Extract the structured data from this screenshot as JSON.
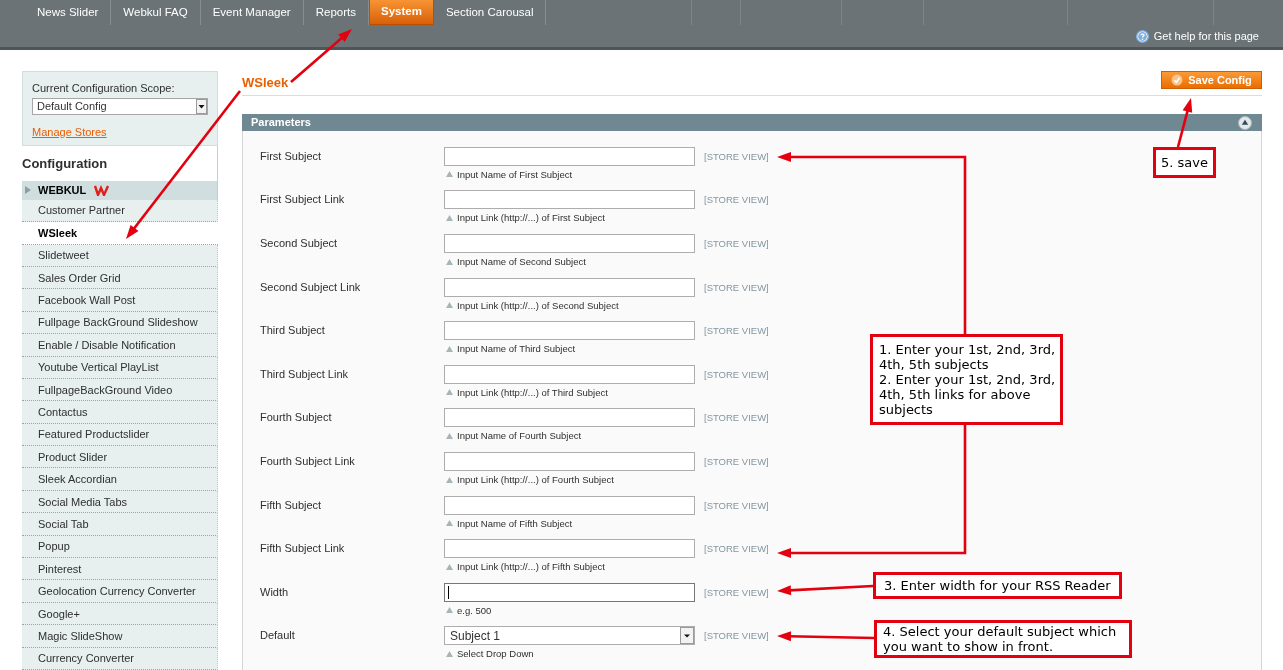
{
  "top_nav": {
    "tabs": [
      {
        "label": "News Slider",
        "selected": false
      },
      {
        "label": "Webkul FAQ",
        "selected": false
      },
      {
        "label": "Event Manager",
        "selected": false
      },
      {
        "label": "Reports",
        "selected": false
      },
      {
        "label": "System",
        "selected": true
      },
      {
        "label": "Section Carousal",
        "selected": false
      }
    ],
    "help_link": "Get help for this page"
  },
  "scope": {
    "label": "Current Configuration Scope:",
    "value": "Default Config",
    "link": "Manage Stores"
  },
  "sidebar": {
    "title": "Configuration",
    "section": "WEBKUL",
    "items": [
      {
        "label": "Customer Partner",
        "selected": false
      },
      {
        "label": "WSleek",
        "selected": true
      },
      {
        "label": "Slidetweet",
        "selected": false
      },
      {
        "label": "Sales Order Grid",
        "selected": false
      },
      {
        "label": "Facebook Wall Post",
        "selected": false
      },
      {
        "label": "Fullpage BackGround Slideshow",
        "selected": false
      },
      {
        "label": "Enable / Disable Notification",
        "selected": false
      },
      {
        "label": "Youtube Vertical PlayList",
        "selected": false
      },
      {
        "label": "FullpageBackGround Video",
        "selected": false
      },
      {
        "label": "Contactus",
        "selected": false
      },
      {
        "label": "Featured Productslider",
        "selected": false
      },
      {
        "label": "Product Slider",
        "selected": false
      },
      {
        "label": "Sleek Accordian",
        "selected": false
      },
      {
        "label": "Social Media Tabs",
        "selected": false
      },
      {
        "label": "Social Tab",
        "selected": false
      },
      {
        "label": "Popup",
        "selected": false
      },
      {
        "label": "Pinterest",
        "selected": false
      },
      {
        "label": "Geolocation Currency Converter",
        "selected": false
      },
      {
        "label": "Google+",
        "selected": false
      },
      {
        "label": "Magic SlideShow",
        "selected": false
      },
      {
        "label": "Currency Converter",
        "selected": false
      }
    ]
  },
  "page": {
    "title": "WSleek",
    "save_button": "Save Config"
  },
  "panel": {
    "title": "Parameters",
    "fields": [
      {
        "label": "First Subject",
        "kind": "text",
        "focused": false,
        "hint": "Input Name of First Subject",
        "scope": "[STORE VIEW]"
      },
      {
        "label": "First Subject Link",
        "kind": "text",
        "focused": false,
        "hint": "Input Link (http://...) of First Subject",
        "scope": "[STORE VIEW]"
      },
      {
        "label": "Second Subject",
        "kind": "text",
        "focused": false,
        "hint": "Input Name of Second Subject",
        "scope": "[STORE VIEW]"
      },
      {
        "label": "Second Subject Link",
        "kind": "text",
        "focused": false,
        "hint": "Input Link (http://...) of Second Subject",
        "scope": "[STORE VIEW]"
      },
      {
        "label": "Third Subject",
        "kind": "text",
        "focused": false,
        "hint": "Input Name of Third Subject",
        "scope": "[STORE VIEW]"
      },
      {
        "label": "Third Subject Link",
        "kind": "text",
        "focused": false,
        "hint": "Input Link (http://...) of Third Subject",
        "scope": "[STORE VIEW]"
      },
      {
        "label": "Fourth Subject",
        "kind": "text",
        "focused": false,
        "hint": "Input Name of Fourth Subject",
        "scope": "[STORE VIEW]"
      },
      {
        "label": "Fourth Subject Link",
        "kind": "text",
        "focused": false,
        "hint": "Input Link (http://...) of Fourth Subject",
        "scope": "[STORE VIEW]"
      },
      {
        "label": "Fifth Subject",
        "kind": "text",
        "focused": false,
        "hint": "Input Name of Fifth Subject",
        "scope": "[STORE VIEW]"
      },
      {
        "label": "Fifth Subject Link",
        "kind": "text",
        "focused": false,
        "hint": "Input Link (http://...) of Fifth Subject",
        "scope": "[STORE VIEW]"
      },
      {
        "label": "Width",
        "kind": "text",
        "focused": true,
        "hint": "e.g. 500",
        "scope": "[STORE VIEW]"
      },
      {
        "label": "Default",
        "kind": "select",
        "focused": false,
        "value": "Subject 1",
        "hint": "Select Drop Down",
        "scope": "[STORE VIEW]"
      }
    ]
  },
  "callouts": [
    {
      "lines": [
        "5. save"
      ]
    },
    {
      "lines": [
        "1. Enter your 1st, 2nd, 3rd, 4th, 5th subjects",
        "2. Enter your 1st, 2nd, 3rd, 4th, 5th links for above subjects"
      ]
    },
    {
      "lines": [
        "3. Enter width for your RSS Reader"
      ]
    },
    {
      "lines": [
        "4. Select your default subject which you want to show in front."
      ]
    }
  ]
}
